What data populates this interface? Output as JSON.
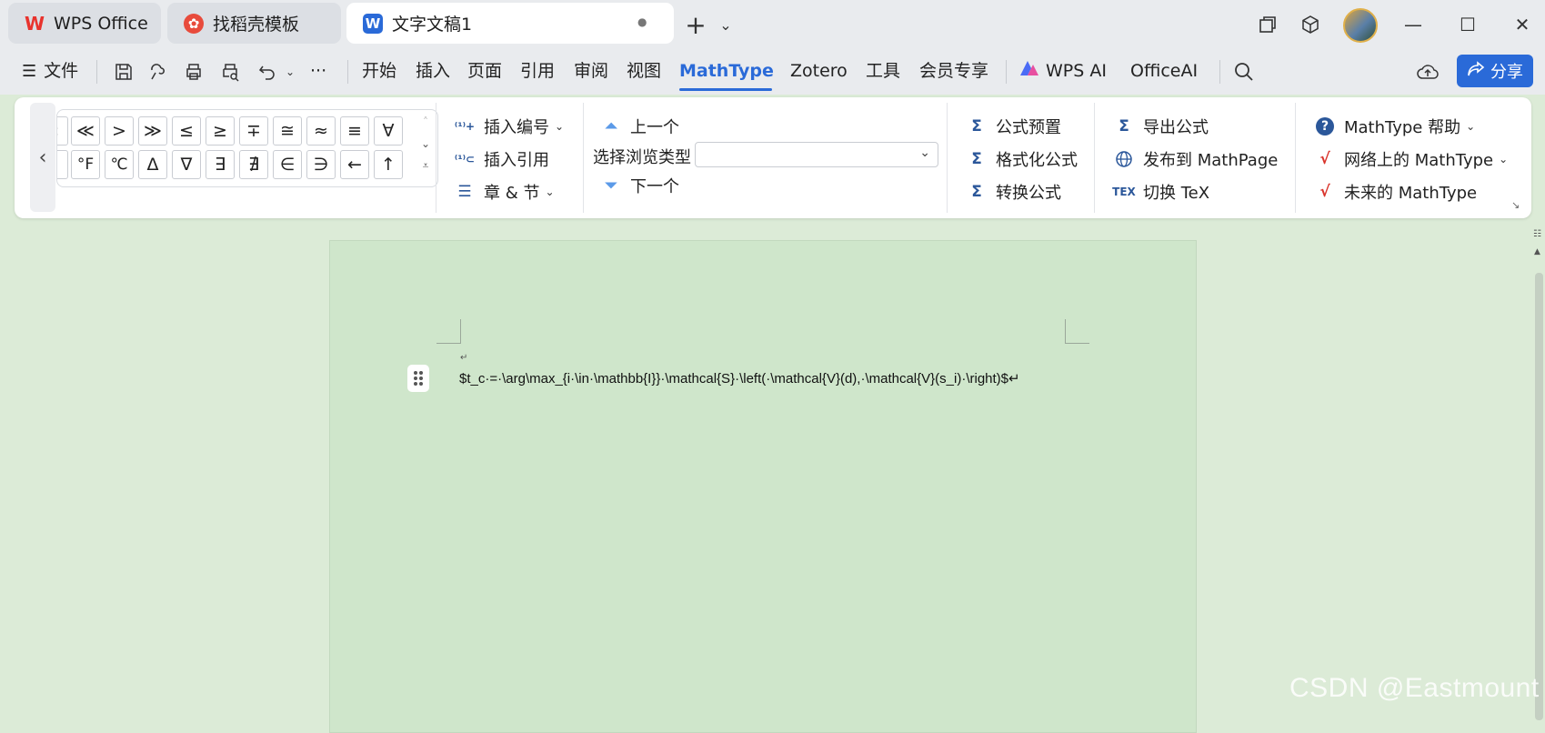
{
  "tabs": [
    {
      "label": "WPS Office",
      "icon": "wps-logo-icon"
    },
    {
      "label": "找稻壳模板",
      "icon": "daoke-icon"
    },
    {
      "label": "文字文稿1",
      "icon": "writer-doc-icon",
      "modified_dot": "●"
    }
  ],
  "window_controls": {
    "new_tab": "+",
    "tab_list": "⌄",
    "minimize": "—",
    "maximize": "☐",
    "close": "✕"
  },
  "menu": {
    "file_label": "文件",
    "more": "···",
    "items": [
      "开始",
      "插入",
      "页面",
      "引用",
      "审阅",
      "视图",
      "MathType",
      "Zotero",
      "工具",
      "会员专享",
      "WPS AI",
      "OfficeAI"
    ],
    "active": "MathType",
    "share_label": "分享"
  },
  "ribbon": {
    "symbols_row1": [
      "«",
      "≪",
      ">",
      "≫",
      "≤",
      "≥",
      "∓",
      "≅",
      "≈",
      "≡",
      "∀"
    ],
    "symbols_row2": [
      "·",
      "°F",
      "℃",
      "Δ",
      "∇",
      "∃",
      "∄",
      "∈",
      "∋",
      "←",
      "↑"
    ],
    "numbering": {
      "insert_number": "插入编号",
      "insert_reference": "插入引用",
      "chapter_section": "章 & 节"
    },
    "browse": {
      "prev": "上一个",
      "type_label": "选择浏览类型",
      "type_value": "",
      "next": "下一个"
    },
    "formula": {
      "preset": "公式预置",
      "format": "格式化公式",
      "convert": "转换公式"
    },
    "export": {
      "export": "导出公式",
      "publish": "发布到 MathPage",
      "toggle_tex": "切换 TeX"
    },
    "help": {
      "help": "MathType 帮助",
      "online": "网络上的 MathType",
      "future": "未来的 MathType"
    }
  },
  "document": {
    "paragraph_mark": "↵",
    "formula_text": "$t_c·=·\\arg\\max_{i·\\in·\\mathbb{I}}·\\mathcal{S}·\\left(·\\mathcal{V}(d),·\\mathcal{V}(s_i)·\\right)$↵"
  },
  "watermark": "CSDN @Eastmount",
  "colors": {
    "accent": "#2a6ad8",
    "page_bg": "#cfe6cb",
    "wps_red": "#e8332d"
  }
}
